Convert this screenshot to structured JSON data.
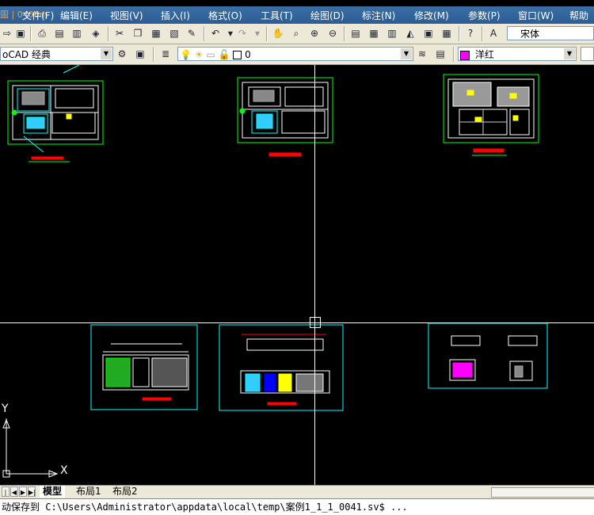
{
  "menu": {
    "ghost_title": "圖 | 0400m",
    "items": [
      "文件(F)",
      "编辑(E)",
      "视图(V)",
      "插入(I)",
      "格式(O)",
      "工具(T)",
      "绘图(D)",
      "标注(N)",
      "修改(M)",
      "参数(P)",
      "窗口(W)",
      "帮助"
    ]
  },
  "toolbar1": {
    "icons": [
      "open-icon",
      "save-icon",
      "print-icon",
      "plot-preview-icon",
      "publish-icon",
      "3d-icon",
      "cut-icon",
      "copy-icon",
      "paste-icon",
      "match-icon",
      "brush-icon",
      "undo-icon",
      "redo-icon",
      "pan-icon",
      "zoom-icon",
      "zoom-window-icon",
      "zoom-previous-icon",
      "properties-icon",
      "design-center-icon",
      "tool-palette-icon",
      "sheet-set-icon",
      "markup-icon",
      "calculator-icon",
      "help-icon",
      "text-style-icon"
    ],
    "font_combo": "宋体"
  },
  "toolbar2": {
    "workspace": "oCAD 经典",
    "layer_value": "0",
    "color_value": "洋红",
    "colors": {
      "magenta": "#ff00ff"
    }
  },
  "tabs": {
    "model": "模型",
    "layout1": "布局1",
    "layout2": "布局2"
  },
  "command_line": "动保存到 C:\\Users\\Administrator\\appdata\\local\\temp\\案例1_1_1_0041.sv$ ...",
  "ucs": {
    "y_label": "Y",
    "x_label": "X"
  }
}
